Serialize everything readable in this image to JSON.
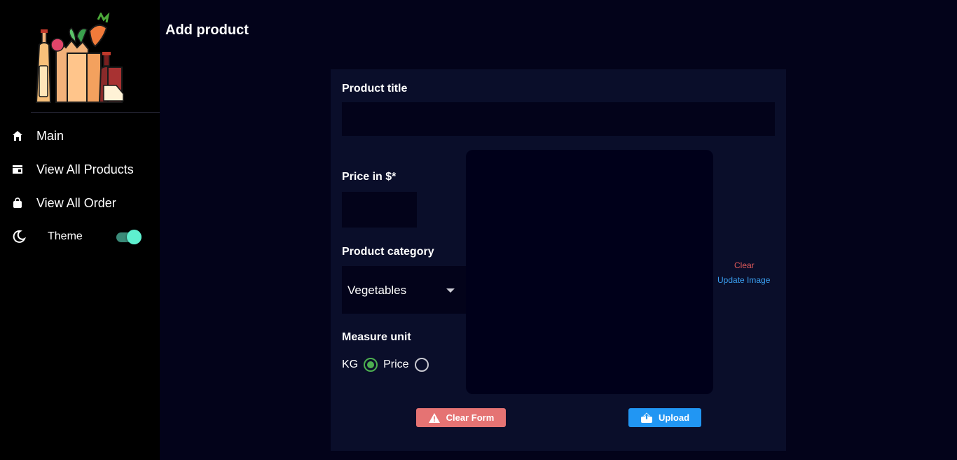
{
  "sidebar": {
    "items": [
      {
        "label": "Main",
        "icon": "home-icon"
      },
      {
        "label": "View All Products",
        "icon": "store-icon"
      },
      {
        "label": "View All Order",
        "icon": "shopping-bag-icon"
      }
    ],
    "theme": {
      "label": "Theme",
      "icon": "moon-icon",
      "enabled": true
    }
  },
  "page": {
    "title": "Add product"
  },
  "form": {
    "title_label": "Product title",
    "title_value": "",
    "price_label": "Price in $*",
    "price_value": "",
    "category_label": "Product category",
    "category_value": "Vegetables",
    "unit_label": "Measure unit",
    "unit_options": [
      "KG",
      "Price"
    ],
    "unit_selected": "KG",
    "image_clear": "Clear",
    "image_update": "Update Image",
    "clear_button": "Clear Form",
    "upload_button": "Upload"
  },
  "colors": {
    "background": "#03031a",
    "sidebar": "#000000",
    "card": "#0a0e2a",
    "clear_button": "#e57373",
    "upload_button": "#2196f3",
    "toggle_on": "#5ef0cf",
    "radio_checked": "#4caf50",
    "link_clear": "#e05a5a",
    "link_update": "#3a9ff0"
  }
}
